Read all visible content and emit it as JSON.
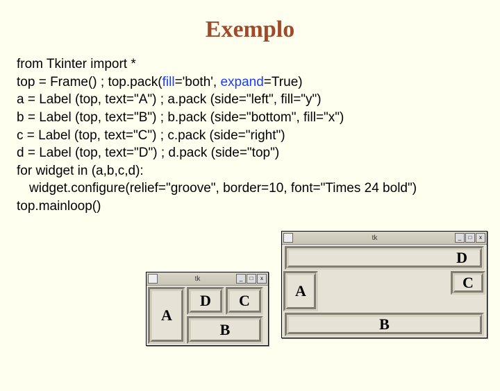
{
  "title": "Exemplo",
  "code": {
    "l1a": "from Tkinter import *",
    "l2a": "top = Frame() ; top.pack(",
    "l2b": "fill",
    "l2c": "='both', ",
    "l2d": "expand",
    "l2e": "=True)",
    "l3": "a = Label (top, text=\"A\") ; a.pack (side=\"left\", fill=\"y\")",
    "l4": "b = Label (top, text=\"B\") ; b.pack (side=\"bottom\", fill=\"x\")",
    "l5": "c = Label (top, text=\"C\") ; c.pack (side=\"right\")",
    "l6": "d = Label (top, text=\"D\") ; d.pack (side=\"top\")",
    "l7": "for widget in (a,b,c,d):",
    "l8": "widget.configure(relief=\"groove\", border=10, font=\"Times 24 bold\")",
    "l9": "top.mainloop()"
  },
  "win_small": {
    "title": "tk",
    "A": "A",
    "B": "B",
    "C": "C",
    "D": "D",
    "min": "_",
    "max": "□",
    "close": "x"
  },
  "win_big": {
    "title": "tk",
    "A": "A",
    "B": "B",
    "C": "C",
    "D": "D",
    "min": "_",
    "max": "□",
    "close": "x"
  }
}
